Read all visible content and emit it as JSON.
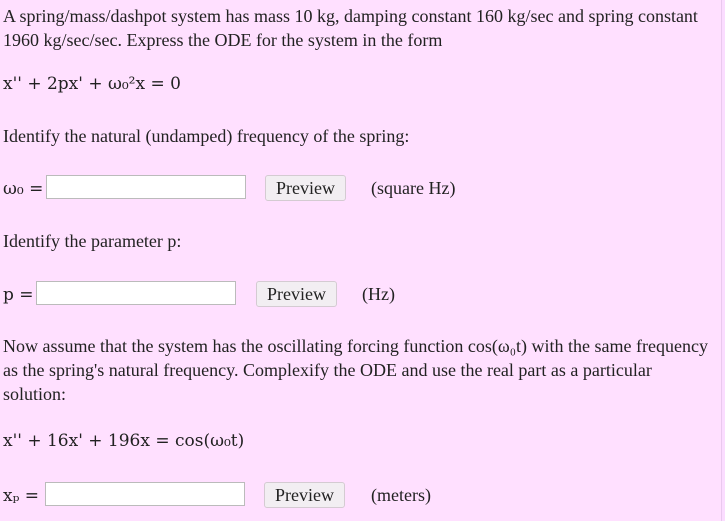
{
  "intro": {
    "text": "A spring/mass/dashpot system has mass 10 kg, damping constant 160 kg/sec and spring constant 1960 kg/sec/sec. Express the ODE for the system in the form"
  },
  "ode_form": {
    "label": "x'' + 2px' + ω₀²x = 0"
  },
  "q1": {
    "prompt": "Identify the natural (undamped) frequency of the spring:",
    "symbol": "ω₀ =",
    "value": "",
    "preview_label": "Preview",
    "unit": "(square Hz)"
  },
  "q2": {
    "prompt": "Identify the parameter p:",
    "symbol": "p =",
    "value": "",
    "preview_label": "Preview",
    "unit": "(Hz)"
  },
  "forcing": {
    "text": "Now assume that the system has the oscillating forcing function cos(ω₀t) with the same frequency as the spring's natural frequency. Complexify the ODE and use the real part as a particular solution:"
  },
  "ode_specific": {
    "label": "x'' + 16x' + 196x = cos(ω₀t)"
  },
  "q3": {
    "symbol": "xₚ =",
    "value": "",
    "preview_label": "Preview",
    "unit": "(meters)"
  }
}
